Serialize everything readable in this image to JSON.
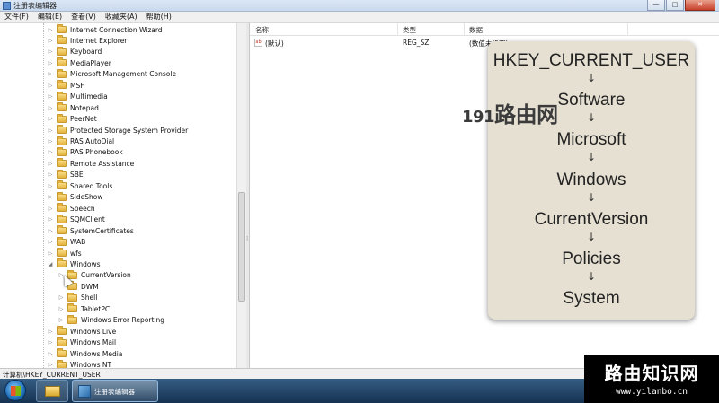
{
  "window": {
    "title": "注册表编辑器",
    "controls": [
      "—",
      "□",
      "✕"
    ]
  },
  "menu": [
    "文件(F)",
    "编辑(E)",
    "查看(V)",
    "收藏夹(A)",
    "帮助(H)"
  ],
  "tree": {
    "items": [
      {
        "label": "Internet Connection Wizard",
        "level": 0,
        "expander": "▷"
      },
      {
        "label": "Internet Explorer",
        "level": 0,
        "expander": "▷"
      },
      {
        "label": "Keyboard",
        "level": 0,
        "expander": "▷"
      },
      {
        "label": "MediaPlayer",
        "level": 0,
        "expander": "▷"
      },
      {
        "label": "Microsoft Management Console",
        "level": 0,
        "expander": "▷"
      },
      {
        "label": "MSF",
        "level": 0,
        "expander": "▷"
      },
      {
        "label": "Multimedia",
        "level": 0,
        "expander": "▷"
      },
      {
        "label": "Notepad",
        "level": 0,
        "expander": "▷"
      },
      {
        "label": "PeerNet",
        "level": 0,
        "expander": "▷"
      },
      {
        "label": "Protected Storage System Provider",
        "level": 0,
        "expander": "▷"
      },
      {
        "label": "RAS AutoDial",
        "level": 0,
        "expander": "▷"
      },
      {
        "label": "RAS Phonebook",
        "level": 0,
        "expander": "▷"
      },
      {
        "label": "Remote Assistance",
        "level": 0,
        "expander": "▷"
      },
      {
        "label": "SBE",
        "level": 0,
        "expander": "▷"
      },
      {
        "label": "Shared Tools",
        "level": 0,
        "expander": "▷"
      },
      {
        "label": "SideShow",
        "level": 0,
        "expander": "▷"
      },
      {
        "label": "Speech",
        "level": 0,
        "expander": "▷"
      },
      {
        "label": "SQMClient",
        "level": 0,
        "expander": "▷"
      },
      {
        "label": "SystemCertificates",
        "level": 0,
        "expander": "▷"
      },
      {
        "label": "WAB",
        "level": 0,
        "expander": "▷"
      },
      {
        "label": "wfs",
        "level": 0,
        "expander": "▷"
      },
      {
        "label": "Windows",
        "level": 0,
        "expander": "◢"
      },
      {
        "label": "CurrentVersion",
        "level": 1,
        "expander": "▷"
      },
      {
        "label": "DWM",
        "level": 1,
        "expander": ""
      },
      {
        "label": "Shell",
        "level": 1,
        "expander": "▷"
      },
      {
        "label": "TabletPC",
        "level": 1,
        "expander": "▷"
      },
      {
        "label": "Windows Error Reporting",
        "level": 1,
        "expander": "▷"
      },
      {
        "label": "Windows Live",
        "level": 0,
        "expander": "▷"
      },
      {
        "label": "Windows Mail",
        "level": 0,
        "expander": "▷"
      },
      {
        "label": "Windows Media",
        "level": 0,
        "expander": "▷"
      },
      {
        "label": "Windows NT",
        "level": 0,
        "expander": "▷"
      }
    ]
  },
  "values": {
    "headers": [
      "名称",
      "类型",
      "数据"
    ],
    "rows": [
      {
        "icon": "ab",
        "name": "(默认)",
        "type": "REG_SZ",
        "data": "(数值未设置)"
      }
    ]
  },
  "overlay": {
    "path": [
      "HKEY_CURRENT_USER",
      "Software",
      "Microsoft",
      "Windows",
      "CurrentVersion",
      "Policies",
      "System"
    ],
    "arrow": "↓"
  },
  "watermark": {
    "num": "191",
    "text": "路由网"
  },
  "statusbar": "计算机\\HKEY_CURRENT_USER",
  "taskbar": {
    "regedit_label": "注册表编辑器"
  },
  "brand": {
    "name": "路由知识网",
    "url": "www.yilanbo.cn"
  },
  "splitter_grip": "⁞",
  "colors": {
    "folder": "#e3b23c",
    "card_bg": "#e6e0d2",
    "taskbar": "#1d3e63"
  }
}
